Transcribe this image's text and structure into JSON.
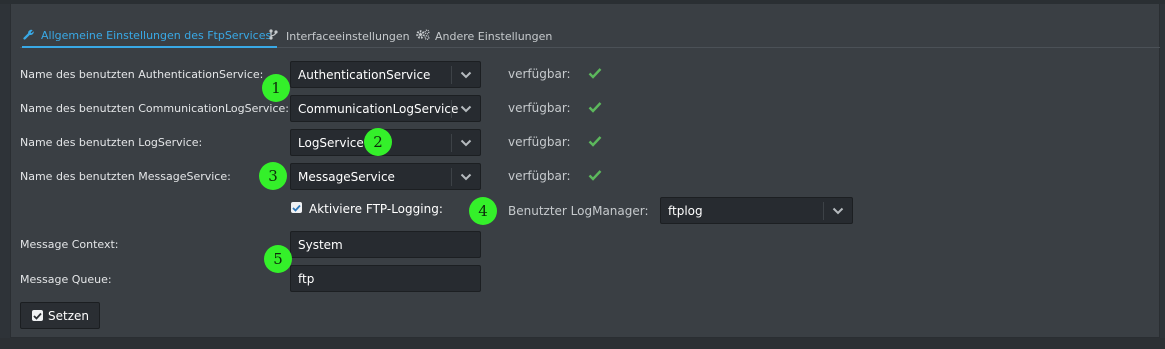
{
  "tabs": [
    {
      "label": "Allgemeine Einstellungen des FtpServices",
      "icon": "wrench-icon",
      "active": true
    },
    {
      "label": "Interfaceeinstellungen",
      "icon": "branch-icon",
      "active": false
    },
    {
      "label": "Andere Einstellungen",
      "icon": "gears-icon",
      "active": false
    }
  ],
  "services": [
    {
      "label": "Name des benutzten AuthenticationService:",
      "value": "AuthenticationService",
      "status": "verfügbar:"
    },
    {
      "label": "Name des benutzten CommunicationLogService:",
      "value": "CommunicationLogService",
      "status": "verfügbar:"
    },
    {
      "label": "Name des benutzten LogService:",
      "value": "LogService",
      "status": "verfügbar:"
    },
    {
      "label": "Name des benutzten MessageService:",
      "value": "MessageService",
      "status": "verfügbar:"
    }
  ],
  "ftp_logging": {
    "label": "Aktiviere FTP-Logging:",
    "checked": true
  },
  "log_manager": {
    "label": "Benutzter LogManager:",
    "value": "ftplog"
  },
  "message_context": {
    "label": "Message Context:",
    "value": "System"
  },
  "message_queue": {
    "label": "Message Queue:",
    "value": "ftp"
  },
  "submit": {
    "label": "Setzen"
  },
  "markers": [
    "1",
    "2",
    "3",
    "4",
    "5"
  ],
  "colors": {
    "accent": "#39a9e6",
    "ok": "#5cb85c",
    "marker": "#34f02a"
  }
}
